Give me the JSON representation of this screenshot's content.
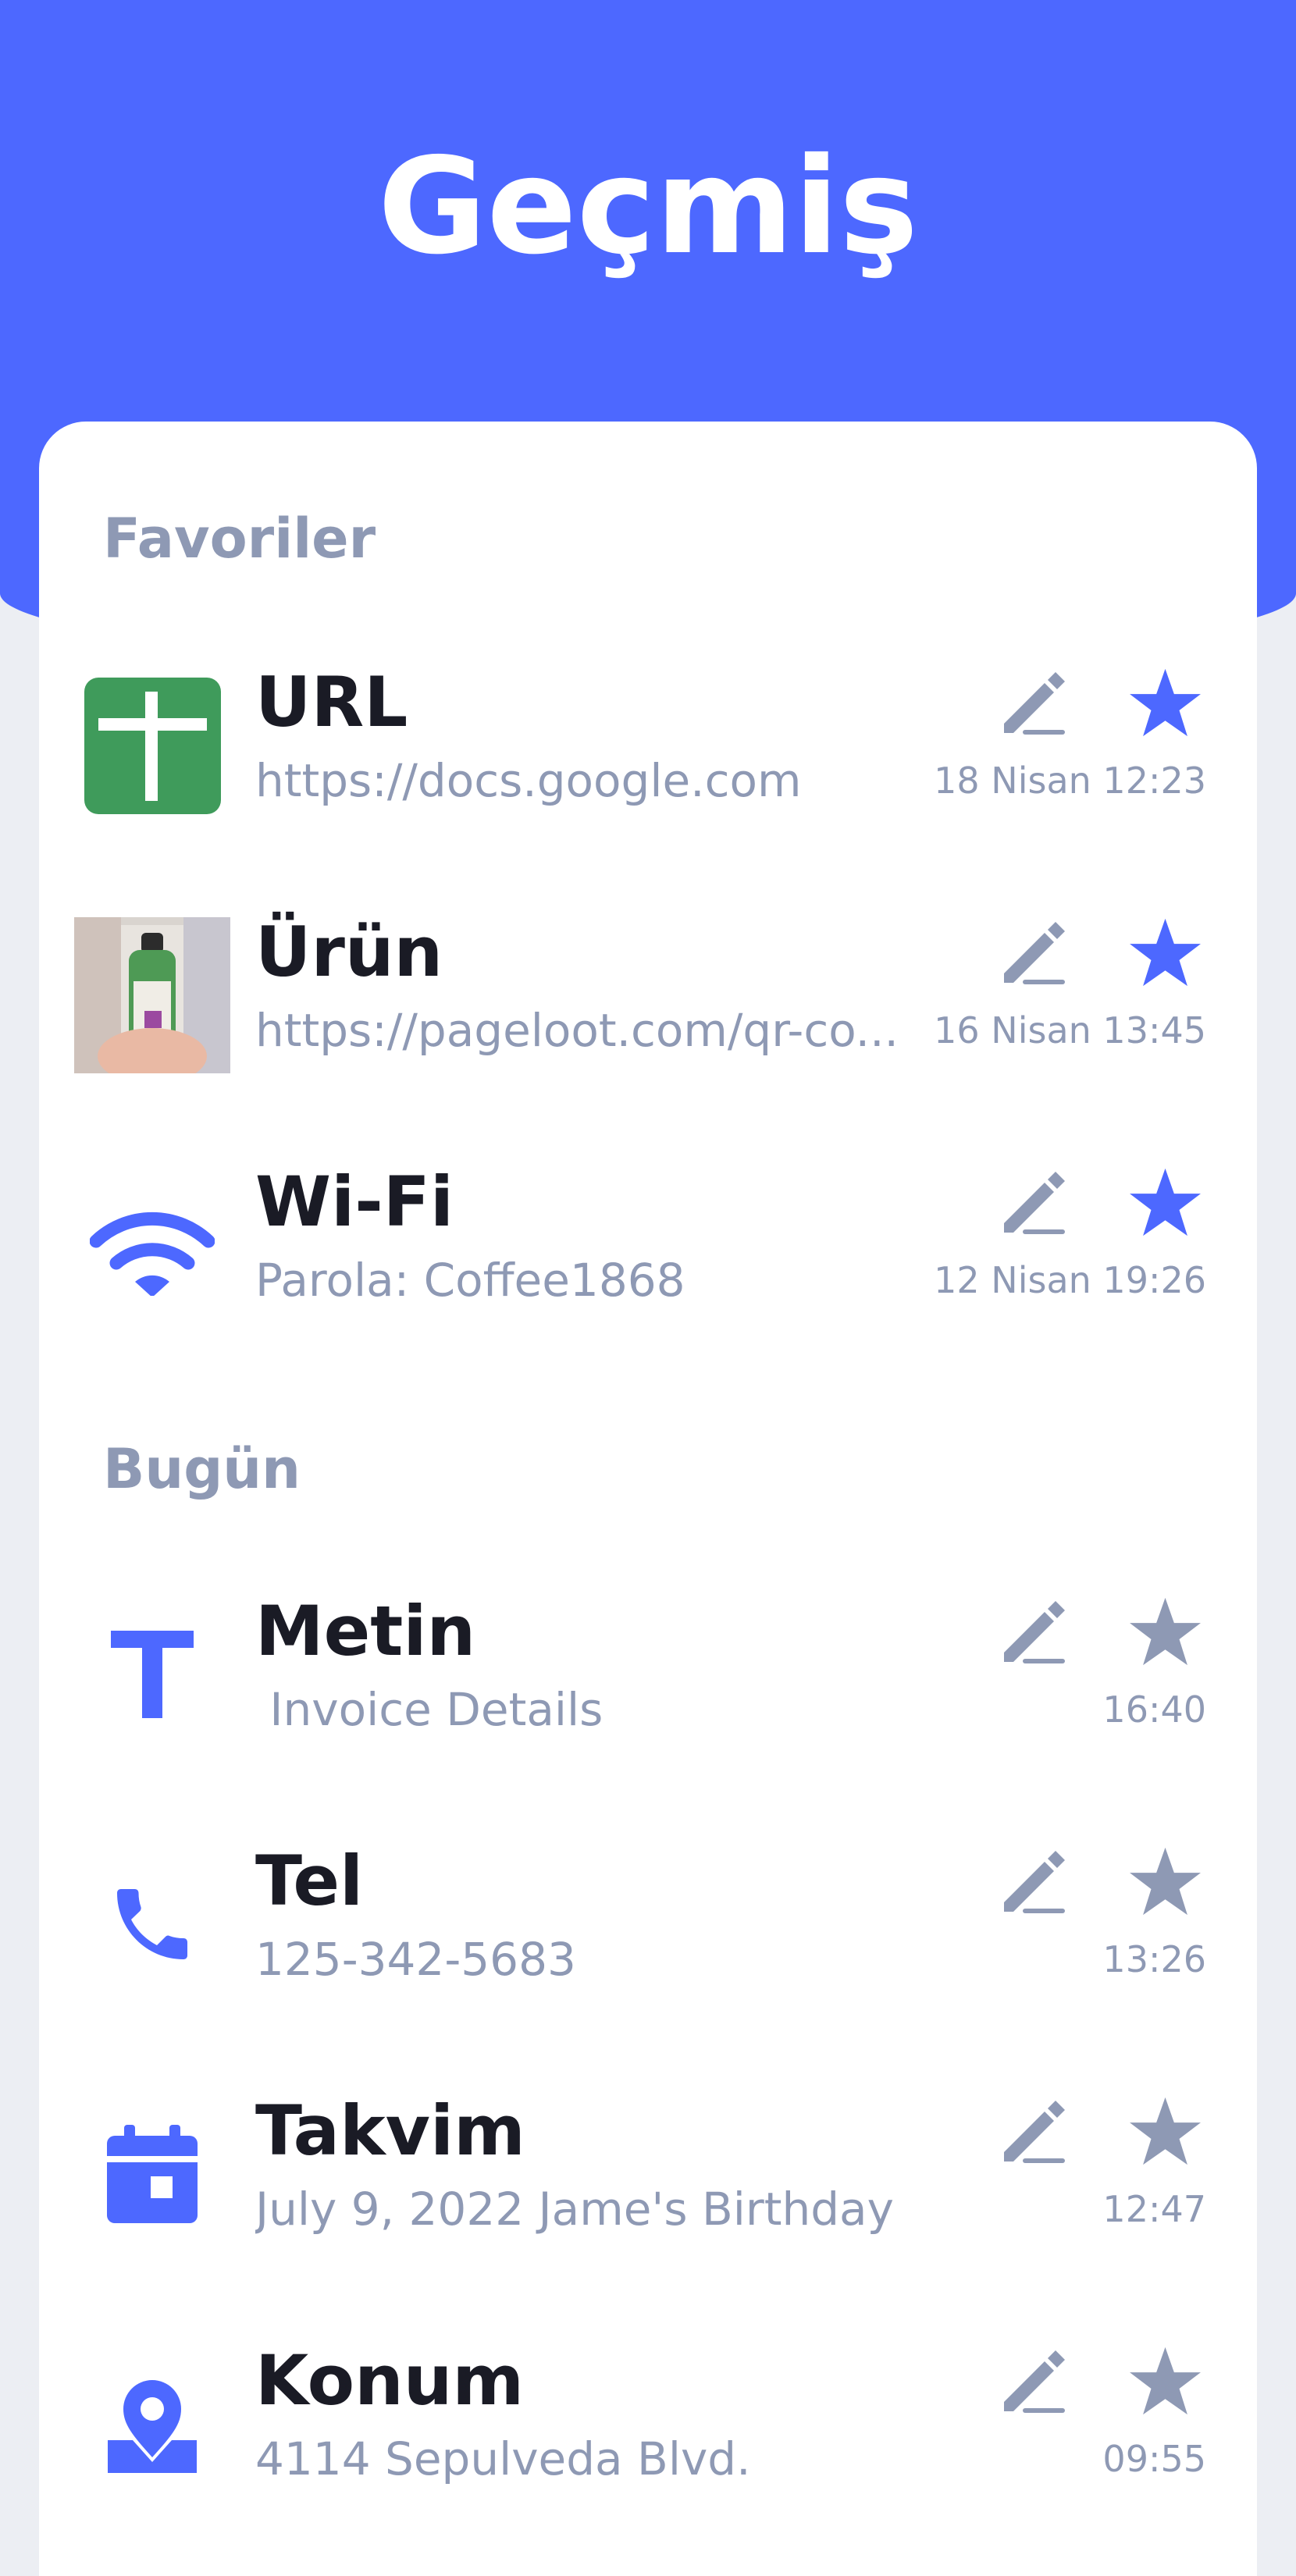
{
  "header": {
    "title": "Geçmiş"
  },
  "sections": {
    "favorites": {
      "title": "Favoriler"
    },
    "today": {
      "title": "Bugün"
    }
  },
  "favorites": [
    {
      "title": "URL",
      "subtitle": "https://docs.google.com",
      "time": "18 Nisan 12:23",
      "icon": "google-docs-icon",
      "starred": true
    },
    {
      "title": "Ürün",
      "subtitle": "https://pageloot.com/qr-co...",
      "time": "16 Nisan 13:45",
      "icon": "product-thumbnail",
      "starred": true
    },
    {
      "title": "Wi-Fi",
      "subtitle": "Parola: Coffee1868",
      "time": "12 Nisan 19:26",
      "icon": "wifi-icon",
      "starred": true
    }
  ],
  "today": [
    {
      "title": "Metin",
      "subtitle": " Invoice Details",
      "time": "16:40",
      "icon": "text-icon",
      "starred": false
    },
    {
      "title": "Tel",
      "subtitle": "125-342-5683",
      "time": "13:26",
      "icon": "phone-icon",
      "starred": false
    },
    {
      "title": "Takvim",
      "subtitle": "July 9, 2022 Jame's Birthday",
      "time": "12:47",
      "icon": "calendar-icon",
      "starred": false
    },
    {
      "title": "Konum",
      "subtitle": "4114 Sepulveda Blvd.",
      "time": "09:55",
      "icon": "location-icon",
      "starred": false
    }
  ],
  "colors": {
    "accent": "#4d68ff",
    "muted": "#8e99b4",
    "text": "#1a1b25",
    "docs_green": "#3f9b5b"
  }
}
